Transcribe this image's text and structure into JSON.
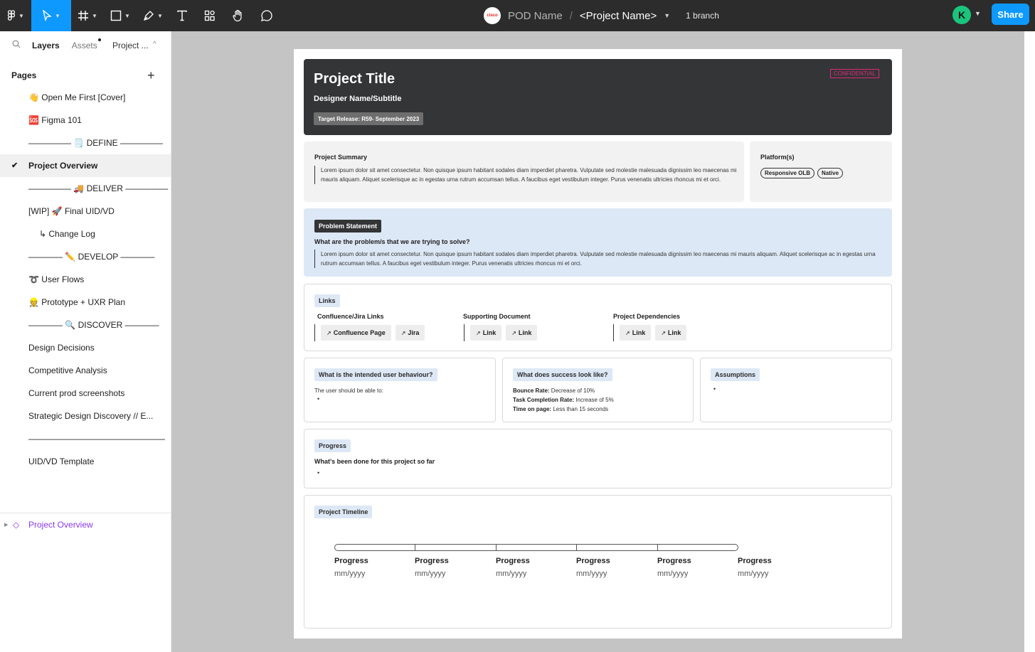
{
  "toolbar": {
    "pod": "POD Name",
    "slash": "/",
    "project": "<Project Name>",
    "branch": "1 branch",
    "avatar_letter": "K",
    "share": "Share",
    "logo_text": "cisco"
  },
  "sidebar": {
    "tabs": {
      "layers": "Layers",
      "assets": "Assets",
      "project": "Project ..."
    },
    "pages_heading": "Pages",
    "pages": [
      "👋 Open Me First [Cover]",
      "🆘 Figma 101",
      "————— 🗒️ DEFINE —————",
      "Project Overview",
      "————— 🚚 DELIVER —————",
      "[WIP] 🚀 Final UID/VD",
      "↳ Change Log",
      "———— ✏️ DEVELOP ————",
      "➰ User Flows",
      "👷 Prototype + UXR Plan",
      "———— 🔍 DISCOVER ————",
      "Design Decisions",
      "Competitive Analysis",
      "Current prod screenshots",
      "Strategic Design Discovery // E...",
      "————————————————",
      "UID/VD Template"
    ],
    "selected_page": "Project Overview",
    "layer": "Project Overview"
  },
  "hero": {
    "title": "Project Title",
    "subtitle": "Designer Name/Subtitle",
    "release": "Target Release: R59- September 2023",
    "confidential": "CONFIDENTIAL"
  },
  "summary": {
    "label": "Project Summary",
    "text": "Lorem ipsum dolor sit amet consectetur. Non quisque ipsum habitant sodales diam imperdiet pharetra. Vulputate sed molestie malesuada dignissim leo maecenas mi mauris aliquam. Aliquet scelerisque ac in egestas urna rutrum accumsan tellus. A faucibus eget vestibulum integer. Purus venenatis ultricies rhoncus mi et orci."
  },
  "platforms": {
    "label": "Platform(s)",
    "items": [
      "Responsive OLB",
      "Native"
    ]
  },
  "problem": {
    "tag": "Problem Statement",
    "question": "What are the problem/s that we are trying to solve?",
    "text": "Lorem ipsum dolor sit amet consectetur. Non quisque ipsum habitant sodales diam imperdiet pharetra. Vulputate sed molestie malesuada dignissim leo maecenas mi mauris aliquam. Aliquet scelerisque ac in egestas urna rutrum accumsan tellus. A faucibus eget vestibulum integer. Purus venenatis ultricies rhoncus mi et orci."
  },
  "links": {
    "tag": "Links",
    "groups": [
      {
        "label": "Confluence/Jira Links",
        "items": [
          "Confluence Page",
          "Jira"
        ]
      },
      {
        "label": "Supporting Document",
        "items": [
          "Link",
          "Link"
        ]
      },
      {
        "label": "Project Dependencies",
        "items": [
          "Link",
          "Link"
        ]
      }
    ]
  },
  "behaviour": {
    "tag": "What is the intended user behaviour?",
    "text": "The user should be able to:",
    "bullet": "•"
  },
  "success": {
    "tag": "What does success look like?",
    "rows": [
      {
        "k": "Bounce Rate:",
        "v": " Decrease of 10%"
      },
      {
        "k": "Task Completion Rate:",
        "v": " Increase of 5%"
      },
      {
        "k": "Time on page:",
        "v": " Less than 15 seconds"
      }
    ]
  },
  "assumptions": {
    "tag": "Assumptions",
    "bullet": "•"
  },
  "progress": {
    "tag": "Progress",
    "text": "What's been done for this project so far",
    "bullet": "•"
  },
  "timeline": {
    "tag": "Project Timeline",
    "items": [
      {
        "label": "Progress",
        "date": "mm/yyyy"
      },
      {
        "label": "Progress",
        "date": "mm/yyyy"
      },
      {
        "label": "Progress",
        "date": "mm/yyyy"
      },
      {
        "label": "Progress",
        "date": "mm/yyyy"
      },
      {
        "label": "Progress",
        "date": "mm/yyyy"
      },
      {
        "label": "Progress",
        "date": "mm/yyyy"
      }
    ]
  }
}
